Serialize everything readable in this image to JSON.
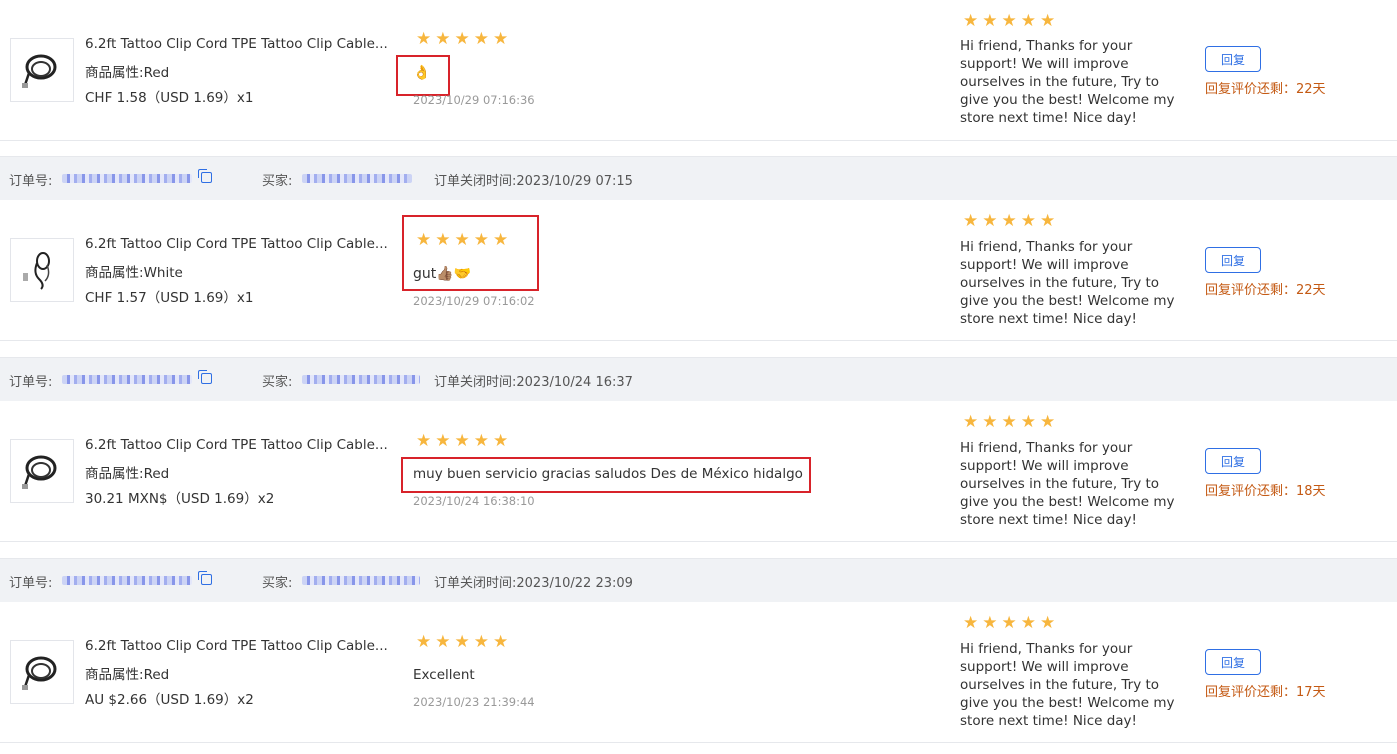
{
  "orders": [
    {
      "product_name": "6.2ft Tattoo Clip Cord TPE Tattoo Clip Cable...",
      "attr_label": "商品属性:",
      "attr_value": "Red",
      "price": "CHF 1.58（USD  1.69）x1",
      "rating": 5,
      "comment": "👌",
      "comment_time": "2023/10/29 07:16:36",
      "reply_rating": 5,
      "reply": "Hi friend, Thanks for your support! We will improve ourselves in the future, Try to give you the best! Welcome my store next time! Nice day!",
      "reply_button": "回复",
      "remaining": "回复评价还剩：22天"
    },
    {
      "header": {
        "order_label": "订单号:",
        "buyer_label": "买家:",
        "close_time": "订单关闭时间:2023/10/29 07:15"
      },
      "product_name": "6.2ft Tattoo Clip Cord TPE Tattoo Clip Cable...",
      "attr_label": "商品属性:",
      "attr_value": "White",
      "price": "CHF 1.57（USD  1.69）x1",
      "rating": 5,
      "comment": "gut👍🏽🤝",
      "comment_time": "2023/10/29 07:16:02",
      "reply_rating": 5,
      "reply": "Hi friend, Thanks for your support! We will improve ourselves in the future, Try to give you the best! Welcome my store next time! Nice day!",
      "reply_button": "回复",
      "remaining": "回复评价还剩：22天"
    },
    {
      "header": {
        "order_label": "订单号:",
        "buyer_label": "买家:",
        "close_time": "订单关闭时间:2023/10/24 16:37"
      },
      "product_name": "6.2ft Tattoo Clip Cord TPE Tattoo Clip Cable...",
      "attr_label": "商品属性:",
      "attr_value": "Red",
      "price": "30.21 MXN$（USD  1.69）x2",
      "rating": 5,
      "comment": "muy buen servicio gracias saludos Des de México hidalgo",
      "comment_time": "2023/10/24 16:38:10",
      "reply_rating": 5,
      "reply": "Hi friend, Thanks for your support! We will improve ourselves in the future, Try to give you the best! Welcome my store next time! Nice day!",
      "reply_button": "回复",
      "remaining": "回复评价还剩：18天"
    },
    {
      "header": {
        "order_label": "订单号:",
        "buyer_label": "买家:",
        "close_time": "订单关闭时间:2023/10/22 23:09"
      },
      "product_name": "6.2ft Tattoo Clip Cord TPE Tattoo Clip Cable...",
      "attr_label": "商品属性:",
      "attr_value": "Red",
      "price": "AU $2.66（USD  1.69）x2",
      "rating": 5,
      "comment": "Excellent",
      "comment_time": "2023/10/23 21:39:44",
      "reply_rating": 5,
      "reply": "Hi friend, Thanks for your support! We will improve ourselves in the future, Try to give you the best! Welcome my store next time! Nice day!",
      "reply_button": "回复",
      "remaining": "回复评价还剩：17天"
    }
  ],
  "colors": {
    "star": "#f7b63e",
    "accent": "#2f6fe4",
    "remaining": "#c45a14",
    "highlight": "#d8232a",
    "header_bg": "#f0f2f5"
  },
  "icons": {
    "copy": "copy-icon",
    "star": "star-icon",
    "product": "product-thumbnail"
  }
}
